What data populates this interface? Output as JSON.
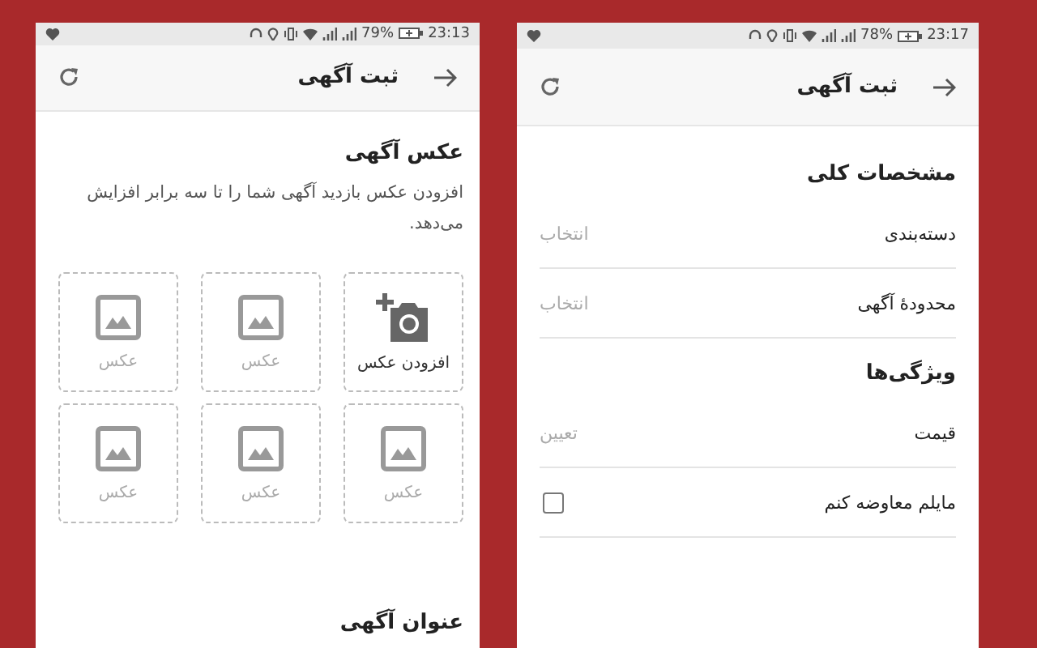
{
  "screens": [
    {
      "status_bar": {
        "battery": "78%",
        "time": "23:17"
      },
      "toolbar": {
        "title": "ثبت آگهی"
      },
      "blocks": [
        {
          "kind": "heading",
          "text": "مشخصات کلی"
        },
        {
          "kind": "select",
          "label": "دسته‌بندی",
          "value": "انتخاب"
        },
        {
          "kind": "select",
          "label": "محدودهٔ آگهی",
          "value": "انتخاب"
        },
        {
          "kind": "heading",
          "text": "ویژگی‌ها"
        },
        {
          "kind": "select",
          "label": "قیمت",
          "value": "تعیین"
        },
        {
          "kind": "checkbox",
          "label": "مایلم معاوضه کنم",
          "checked": false
        }
      ]
    },
    {
      "status_bar": {
        "battery": "79%",
        "time": "23:13"
      },
      "toolbar": {
        "title": "ثبت آگهی"
      },
      "blocks": [
        {
          "kind": "heading",
          "text": "عکس آگهی"
        },
        {
          "kind": "paragraph",
          "text": "افزودن عکس بازدید آگهی شما را تا سه برابر افزایش می‌دهد."
        },
        {
          "kind": "tiles",
          "tiles": [
            {
              "kind": "add",
              "label": "افزودن عکس"
            },
            {
              "kind": "empty",
              "label": "عکس"
            },
            {
              "kind": "empty",
              "label": "عکس"
            },
            {
              "kind": "empty",
              "label": "عکس"
            },
            {
              "kind": "empty",
              "label": "عکس"
            },
            {
              "kind": "empty",
              "label": "عکس"
            }
          ]
        },
        {
          "kind": "heading",
          "text": "عنوان آگهی"
        }
      ]
    }
  ]
}
